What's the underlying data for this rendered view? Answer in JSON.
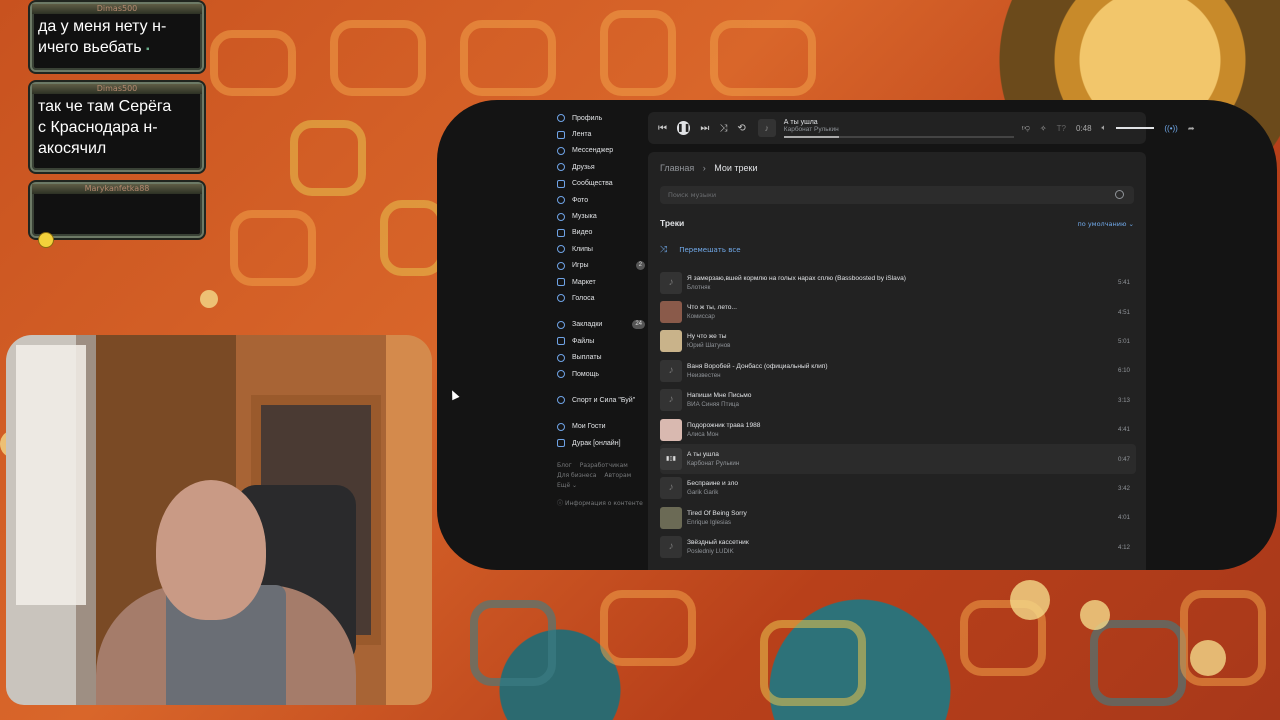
{
  "chat": [
    {
      "author": "Dimas500",
      "text": "да у меня нету н-\nичего вьебать"
    },
    {
      "author": "Dimas500",
      "text": "так че там Серёга\nс Краснодара н-\nакосячил"
    },
    {
      "author": "Marykanfetka88",
      "text": ""
    }
  ],
  "sidebar": {
    "items": [
      {
        "label": "Профиль",
        "icon": "profile-icon"
      },
      {
        "label": "Лента",
        "icon": "feed-icon"
      },
      {
        "label": "Мессенджер",
        "icon": "messenger-icon"
      },
      {
        "label": "Друзья",
        "icon": "friends-icon"
      },
      {
        "label": "Сообщества",
        "icon": "communities-icon"
      },
      {
        "label": "Фото",
        "icon": "photo-icon"
      },
      {
        "label": "Музыка",
        "icon": "music-icon"
      },
      {
        "label": "Видео",
        "icon": "video-icon"
      },
      {
        "label": "Клипы",
        "icon": "clips-icon"
      },
      {
        "label": "Игры",
        "icon": "games-icon",
        "badge": "2"
      },
      {
        "label": "Маркет",
        "icon": "market-icon"
      },
      {
        "label": "Голоса",
        "icon": "votes-icon"
      }
    ],
    "items2": [
      {
        "label": "Закладки",
        "icon": "bookmarks-icon",
        "badge": "24"
      },
      {
        "label": "Файлы",
        "icon": "files-icon"
      },
      {
        "label": "Выплаты",
        "icon": "payments-icon"
      },
      {
        "label": "Помощь",
        "icon": "help-icon"
      }
    ],
    "items3": [
      {
        "label": "Спорт и Сила \"Буй\"",
        "icon": "group-icon"
      }
    ],
    "items4": [
      {
        "label": "Мои Гости",
        "icon": "apps-icon"
      },
      {
        "label": "Дурак [онлайн]",
        "icon": "game-icon"
      }
    ],
    "footer": {
      "blog": "Блог",
      "devs": "Разработчикам",
      "business": "Для бизнеса",
      "authors": "Авторам",
      "more": "Ещё ⌄",
      "content_info": "Информация о контенте"
    }
  },
  "player": {
    "title": "А ты ушла",
    "artist": "Карбонат Рулькин",
    "time": "0:48",
    "progress": 0.24
  },
  "breadcrumb": {
    "home": "Главная",
    "sep": "›",
    "current": "Мои треки"
  },
  "search": {
    "placeholder": "Поиск музыки"
  },
  "tracks_section": {
    "title": "Треки",
    "sort": "по умолчанию ⌄",
    "shuffle": "Перемешать все"
  },
  "tracks": [
    {
      "title": "Я замерзаю,вшей кормлю на голых нарах сплю (Bassboosted by iSlava)",
      "artist": "Блотняк",
      "duration": "5:41",
      "cover": "note",
      "color": "#333"
    },
    {
      "title": "Что ж ты, лето...",
      "artist": "Комиссар",
      "duration": "4:51",
      "cover": "img",
      "color": "#8a5a4a"
    },
    {
      "title": "Ну что же ты",
      "artist": "Юрий Шатунов",
      "duration": "5:01",
      "cover": "img",
      "color": "#c9b38a"
    },
    {
      "title": "Ваня Воробей - Донбасс (официальный клип)",
      "artist": "Неизвестен",
      "duration": "6:10",
      "cover": "note",
      "color": "#333"
    },
    {
      "title": "Напиши Мне Письмо",
      "artist": "ВИА Синяя Птица",
      "duration": "3:13",
      "cover": "note",
      "color": "#333"
    },
    {
      "title": "Подорожник трава 1988",
      "artist": "Алиса Мон",
      "duration": "4:41",
      "cover": "img",
      "color": "#d9b9b0"
    },
    {
      "title": "А ты ушла",
      "artist": "Карбонат Рулькин",
      "duration": "0:47",
      "cover": "bars",
      "color": "#3a3a3a",
      "active": true
    },
    {
      "title": "Беспраине и зло",
      "artist": "Garik Garik",
      "duration": "3:42",
      "cover": "note",
      "color": "#333"
    },
    {
      "title": "Tired Of Being Sorry",
      "artist": "Enrique Iglesias",
      "duration": "4:01",
      "cover": "img",
      "color": "#6b6a55"
    },
    {
      "title": "Звёздный кассетник",
      "artist": "Posledniy LUDIK",
      "duration": "4:12",
      "cover": "note",
      "color": "#333"
    }
  ]
}
